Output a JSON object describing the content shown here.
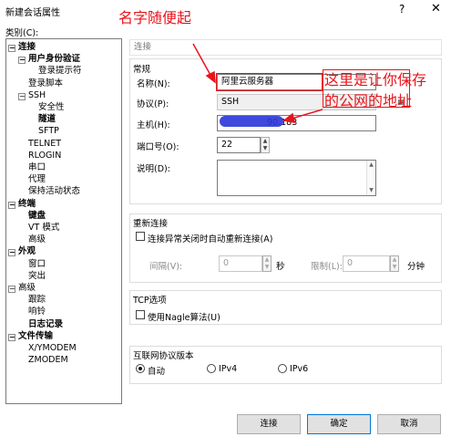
{
  "window": {
    "title": "新建会话属性",
    "help_glyph": "?",
    "close_glyph": "✕"
  },
  "category_label": "类别(C):",
  "tree": [
    {
      "text": "连接",
      "bold": true,
      "toggle": "−"
    },
    {
      "text": "用户身份验证",
      "bold": true,
      "toggle": "−"
    },
    {
      "text": "登录提示符",
      "bold": false,
      "toggle": ""
    },
    {
      "text": "登录脚本",
      "bold": false,
      "toggle": ""
    },
    {
      "text": "SSH",
      "bold": false,
      "toggle": "−"
    },
    {
      "text": "安全性",
      "bold": false,
      "toggle": ""
    },
    {
      "text": "隧道",
      "bold": true,
      "toggle": ""
    },
    {
      "text": "SFTP",
      "bold": false,
      "toggle": ""
    },
    {
      "text": "TELNET",
      "bold": false,
      "toggle": ""
    },
    {
      "text": "RLOGIN",
      "bold": false,
      "toggle": ""
    },
    {
      "text": "串口",
      "bold": false,
      "toggle": ""
    },
    {
      "text": "代理",
      "bold": false,
      "toggle": ""
    },
    {
      "text": "保持活动状态",
      "bold": false,
      "toggle": ""
    },
    {
      "text": "终端",
      "bold": true,
      "toggle": "−"
    },
    {
      "text": "键盘",
      "bold": true,
      "toggle": ""
    },
    {
      "text": "VT 模式",
      "bold": false,
      "toggle": ""
    },
    {
      "text": "高级",
      "bold": false,
      "toggle": ""
    },
    {
      "text": "外观",
      "bold": true,
      "toggle": "−"
    },
    {
      "text": "窗口",
      "bold": false,
      "toggle": ""
    },
    {
      "text": "突出",
      "bold": false,
      "toggle": ""
    },
    {
      "text": "高级",
      "bold": false,
      "toggle": "−"
    },
    {
      "text": "跟踪",
      "bold": false,
      "toggle": ""
    },
    {
      "text": "响铃",
      "bold": false,
      "toggle": ""
    },
    {
      "text": "日志记录",
      "bold": true,
      "toggle": ""
    },
    {
      "text": "文件传输",
      "bold": true,
      "toggle": "−"
    },
    {
      "text": "X/YMODEM",
      "bold": false,
      "toggle": ""
    },
    {
      "text": "ZMODEM",
      "bold": false,
      "toggle": ""
    }
  ],
  "breadcrumb": "连接",
  "general": {
    "section": "常规",
    "name_label": "名称(N):",
    "name_value": "阿里云服务器",
    "protocol_label": "协议(P):",
    "protocol_value": "SSH",
    "host_label": "主机(H):",
    "host_value": "90.183",
    "port_label": "端口号(O):",
    "port_value": "22",
    "desc_label": "说明(D):"
  },
  "reconnect": {
    "section": "重新连接",
    "checkbox_label": "连接异常关闭时自动重新连接(A)",
    "interval_label": "间隔(V):",
    "interval_value": "0",
    "interval_unit": "秒",
    "limit_label": "限制(L):",
    "limit_value": "0",
    "limit_unit": "分钟"
  },
  "tcp": {
    "section": "TCP选项",
    "checkbox_label": "使用Nagle算法(U)"
  },
  "ipver": {
    "section": "互联网协议版本",
    "options": [
      "自动",
      "IPv4",
      "IPv6"
    ],
    "selected": "自动"
  },
  "buttons": {
    "connect": "连接",
    "ok": "确定",
    "cancel": "取消"
  },
  "annotations": {
    "name_note": "名字随便起",
    "host_note_line1": "这里是让你保存",
    "host_note_line2": "的公网的地址"
  },
  "colors": {
    "annotation_red": "#e8141c",
    "default_button_border": "#0078d7",
    "scribble_blue": "#2a35d8"
  }
}
